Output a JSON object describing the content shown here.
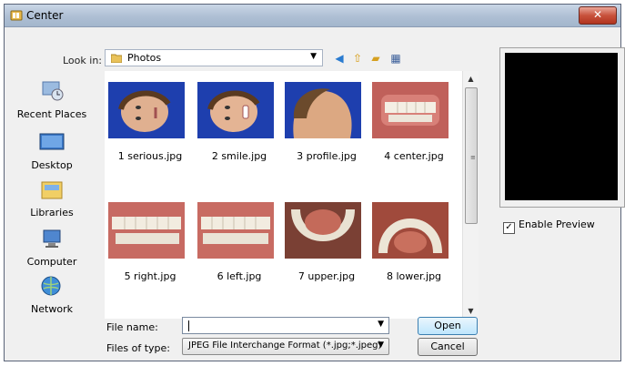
{
  "window": {
    "title": "Center",
    "close_glyph": "✕"
  },
  "toolbar": {
    "look_in_label": "Look in:",
    "look_in_value": "Photos",
    "icons": [
      "back-icon",
      "up-folder-icon",
      "new-folder-icon",
      "views-menu-icon"
    ]
  },
  "places": [
    {
      "label": "Recent Places",
      "icon": "recent-places-icon"
    },
    {
      "label": "Desktop",
      "icon": "desktop-icon"
    },
    {
      "label": "Libraries",
      "icon": "libraries-icon"
    },
    {
      "label": "Computer",
      "icon": "computer-icon"
    },
    {
      "label": "Network",
      "icon": "network-icon"
    }
  ],
  "files": [
    {
      "name": "1 serious.jpg",
      "kind": "face"
    },
    {
      "name": "2 smile.jpg",
      "kind": "face"
    },
    {
      "name": "3 profile.jpg",
      "kind": "profile"
    },
    {
      "name": "4 center.jpg",
      "kind": "teeth"
    },
    {
      "name": "5 right.jpg",
      "kind": "teeth"
    },
    {
      "name": "6 left.jpg",
      "kind": "teeth"
    },
    {
      "name": "7 upper.jpg",
      "kind": "arch"
    },
    {
      "name": "8 lower.jpg",
      "kind": "arch"
    }
  ],
  "preview": {
    "enable_label": "Enable Preview",
    "enabled": true
  },
  "form": {
    "file_name_label": "File name:",
    "file_name_value": "",
    "files_of_type_label": "Files of type:",
    "files_of_type_value": "JPEG File Interchange Format (*.jpg;*.jpeg)"
  },
  "buttons": {
    "open": "Open",
    "cancel": "Cancel"
  },
  "colors": {
    "accent": "#3c7fb1",
    "close": "#c8523c",
    "photo_bg": "#1e3fae"
  }
}
